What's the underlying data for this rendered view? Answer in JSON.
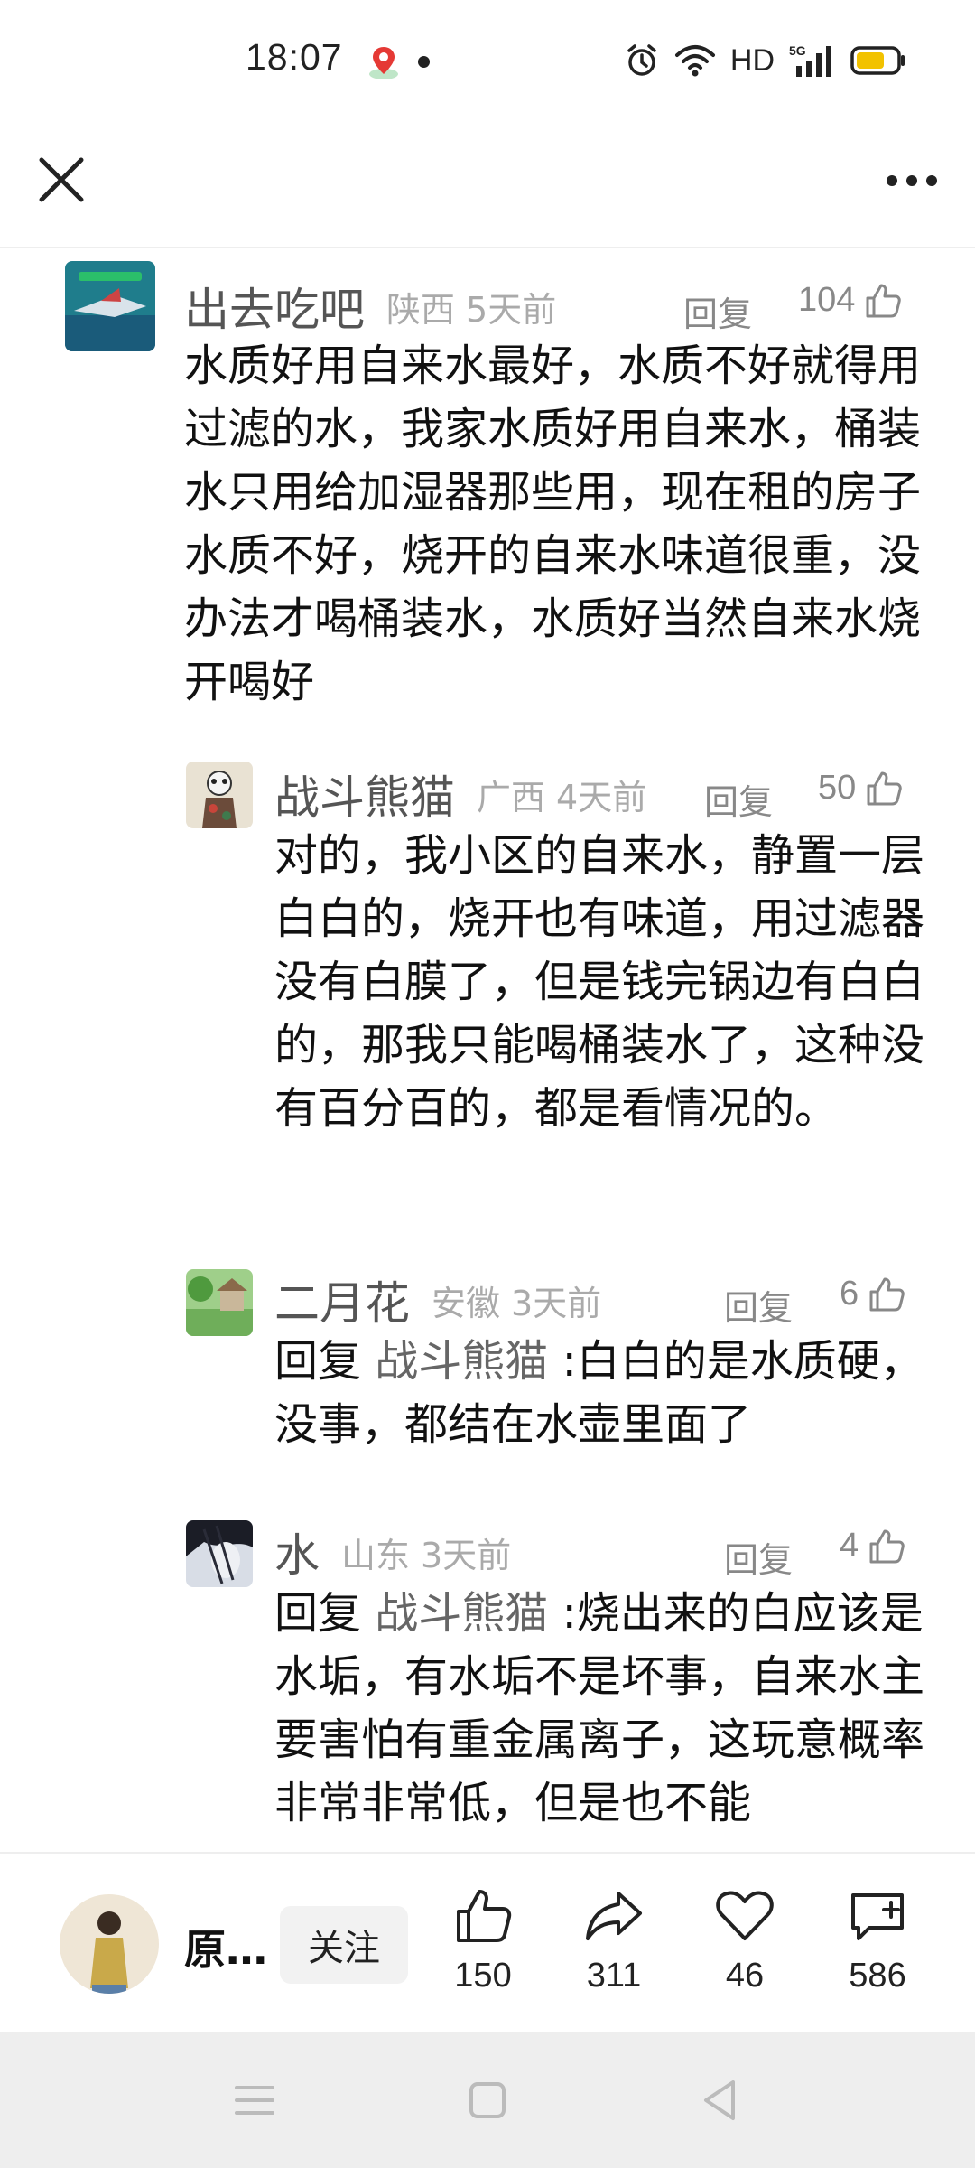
{
  "status_bar": {
    "time": "18:07",
    "network_label": "HD",
    "signal_label": "5G"
  },
  "top_bar": {
    "close_icon": "close-icon",
    "more_icon": "more-icon"
  },
  "comments": [
    {
      "username": "出去吃吧",
      "location": "陕西",
      "time": "5天前",
      "reply_label": "回复",
      "likes": "104",
      "text": "水质好用自来水最好，水质不好就得用过滤的水，我家水质好用自来水，桶装水只用给加湿器那些用，现在租的房子水质不好，烧开的自来水味道很重，没办法才喝桶装水，水质好当然自来水烧开喝好"
    },
    {
      "username": "战斗熊猫",
      "location": "广西",
      "time": "4天前",
      "reply_label": "回复",
      "likes": "50",
      "text": "对的，我小区的自来水，静置一层白白的，烧开也有味道，用过滤器没有白膜了，但是钱完锅边有白白的，那我只能喝桶装水了，这种没有百分百的，都是看情况的。"
    },
    {
      "username": "二月花",
      "location": "安徽",
      "time": "3天前",
      "reply_label": "回复",
      "likes": "6",
      "reply_prefix": "回复",
      "mention": "战斗熊猫",
      "text": ":白白的是水质硬，没事，都结在水壶里面了"
    },
    {
      "username": "水",
      "location": "山东",
      "time": "3天前",
      "reply_label": "回复",
      "likes": "4",
      "reply_prefix": "回复",
      "mention": "战斗熊猫",
      "text": ":烧出来的白应该是水垢，有水垢不是坏事，自来水主要害怕有重金属离子，这玩意概率非常非常低，但是也不能"
    }
  ],
  "action_bar": {
    "author_name": "原…",
    "follow_label": "关注",
    "like_count": "150",
    "share_count": "311",
    "favorite_count": "46",
    "comment_count": "586"
  },
  "colors": {
    "battery": "#f2c200",
    "muted_text": "#aaaaaa",
    "meta_text": "#888888"
  }
}
